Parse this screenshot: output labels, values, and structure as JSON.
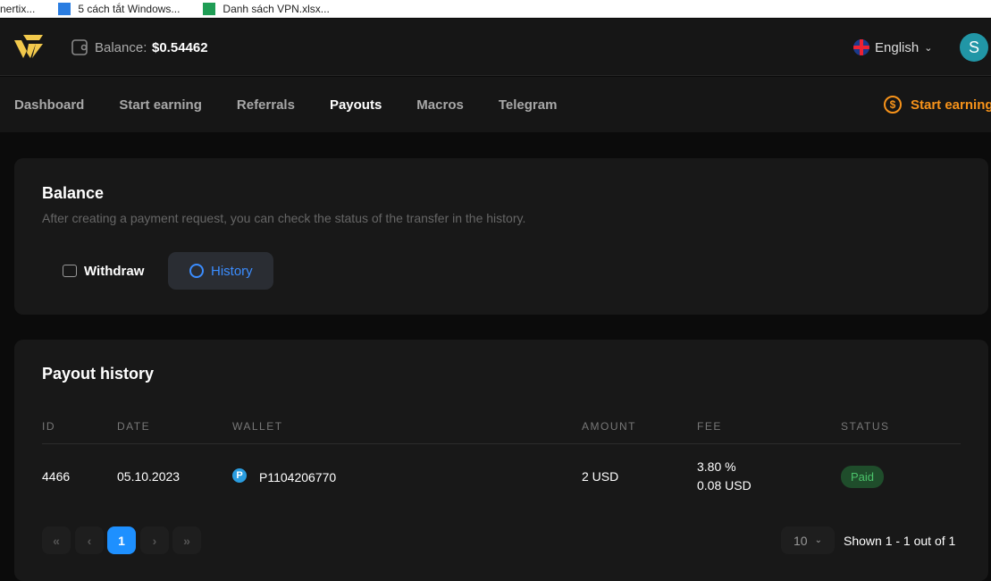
{
  "bookmarks": [
    "nertix...",
    "5 cách tắt Windows...",
    "Danh sách VPN.xlsx..."
  ],
  "header": {
    "balance_label": "Balance:",
    "balance_value": "$0.54462",
    "language": "English",
    "avatar_letter": "S"
  },
  "nav": {
    "items": [
      "Dashboard",
      "Start earning",
      "Referrals",
      "Payouts",
      "Macros",
      "Telegram"
    ],
    "active": "Payouts",
    "cta": "Start earning"
  },
  "balance_card": {
    "title": "Balance",
    "subtitle": "After creating a payment request, you can check the status of the transfer in the history.",
    "tabs": [
      "Withdraw",
      "History"
    ],
    "active_tab": "History"
  },
  "history": {
    "title": "Payout history",
    "columns": [
      "ID",
      "DATE",
      "WALLET",
      "AMOUNT",
      "FEE",
      "STATUS"
    ],
    "rows": [
      {
        "id": "4466",
        "date": "05.10.2023",
        "wallet": "P1104206770",
        "amount": "2 USD",
        "fee_pct": "3.80 %",
        "fee_amt": "0.08 USD",
        "status": "Paid"
      }
    ]
  },
  "pagination": {
    "current": "1",
    "per_page": "10",
    "summary": "Shown 1 - 1 out of 1",
    "first": "«",
    "prev": "‹",
    "next": "›",
    "last": "»"
  },
  "colors": {
    "accent": "#1e90ff",
    "logo": "#f2c94c",
    "cta": "#f7931a",
    "paid_bg": "#1f4d2b",
    "paid_text": "#4cc36b"
  }
}
